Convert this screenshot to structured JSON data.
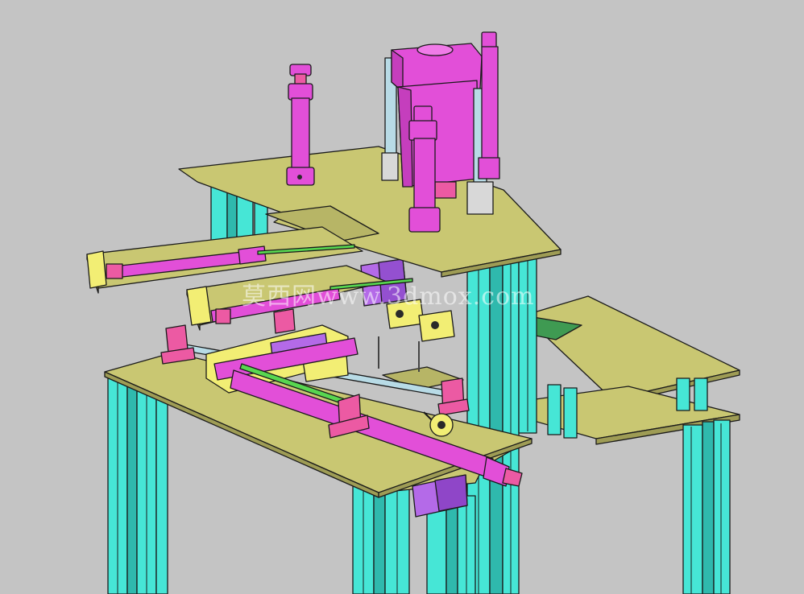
{
  "watermark": {
    "text": "莫西网www.3dmox.com"
  },
  "colors": {
    "background": "#c4c4c4",
    "plate": "#c9c772",
    "column": "#46e6d6",
    "cylinder": "#e24fd8",
    "bracket": "#ec5aa3",
    "block": "#b46ae8",
    "part_yellow": "#f2ee74",
    "rod_steel": "#b8dbe6",
    "rail_green": "#58d650"
  }
}
